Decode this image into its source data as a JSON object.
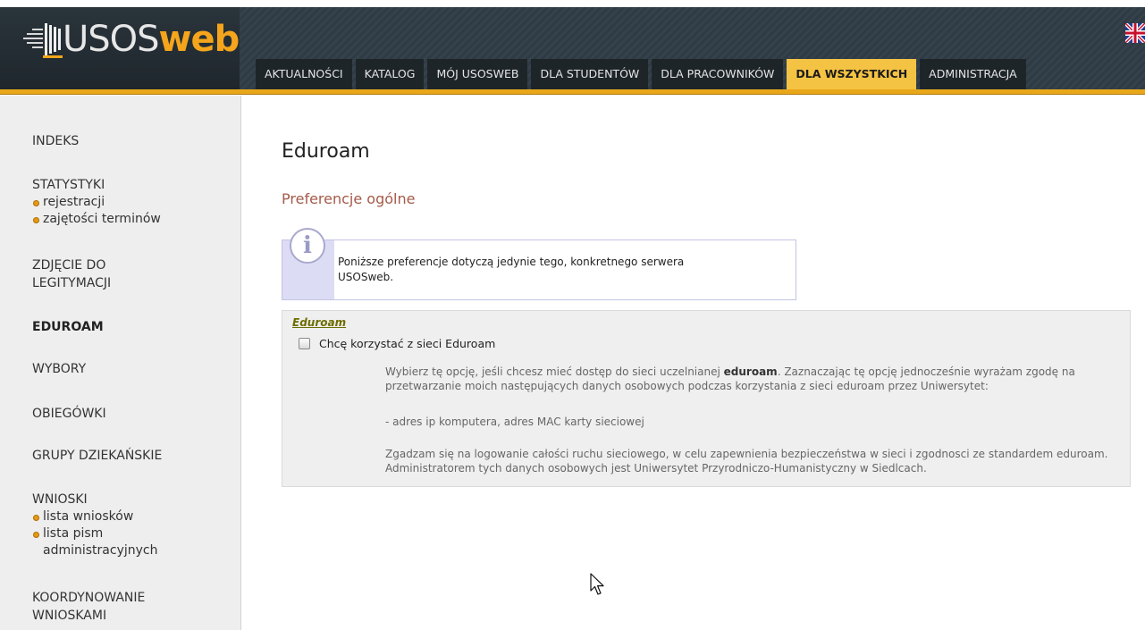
{
  "header": {
    "logo_usos": "USOS",
    "logo_web": "web",
    "flag_icon": "uk-flag-icon",
    "tabs": [
      {
        "label": "AKTUALNOŚCI",
        "active": false
      },
      {
        "label": "KATALOG",
        "active": false
      },
      {
        "label": "MÓJ USOSWEB",
        "active": false
      },
      {
        "label": "DLA STUDENTÓW",
        "active": false
      },
      {
        "label": "DLA PRACOWNIKÓW",
        "active": false
      },
      {
        "label": "DLA WSZYSTKICH",
        "active": true
      },
      {
        "label": "ADMINISTRACJA",
        "active": false
      }
    ]
  },
  "sidebar": {
    "indeks": "INDEKS",
    "statystyki": {
      "label": "STATYSTYKI",
      "items": [
        "rejestracji",
        "zajętości terminów"
      ]
    },
    "zdjecie": {
      "line1": "ZDJĘCIE DO",
      "line2": "LEGITYMACJI"
    },
    "eduroam": "EDUROAM",
    "wybory": "WYBORY",
    "obiegowki": "OBIEGÓWKI",
    "grupy": "GRUPY DZIEKAŃSKIE",
    "wnioski": {
      "label": "WNIOSKI",
      "item1": "lista wniosków",
      "item2_line1": "lista pism",
      "item2_line2": "administracyjnych"
    },
    "koordynowanie": {
      "line1": "KOORDYNOWANIE",
      "line2": "WNIOSKAMI"
    }
  },
  "main": {
    "title": "Eduroam",
    "section_title": "Preferencje ogólne",
    "info_icon": "info-icon",
    "info_text": "Poniższe preferencje dotyczą jedynie tego, konkretnego serwera USOSweb.",
    "pref_panel": {
      "legend": "Eduroam",
      "checkbox_checked": false,
      "checkbox_label": "Chcę korzystać z sieci Eduroam",
      "desc_p1_before": "Wybierz tę opcję, jeśli chcesz mieć dostęp do sieci uczelnianej ",
      "desc_p1_bold": "eduroam",
      "desc_p1_after": ". Zaznaczając tę opcję jednocześnie wyrażam zgodę na przetwarzanie moich następujących danych osobowych podczas korzystania z sieci eduroam przez Uniwersytet:",
      "desc_p2": "- adres ip komputera, adres MAC karty sieciowej",
      "desc_p3": "Zgadzam się na logowanie całości ruchu sieciowego, w celu zapewnienia bezpieczeństwa w sieci i zgodnosci ze standardem eduroam. Administratorem tych danych osobowych jest Uniwersytet Przyrodniczo-Humanistyczny w Siedlcach."
    }
  },
  "colors": {
    "accent_gold": "#e8a719",
    "active_tab": "#f5c343",
    "section_title": "#a45a48"
  }
}
